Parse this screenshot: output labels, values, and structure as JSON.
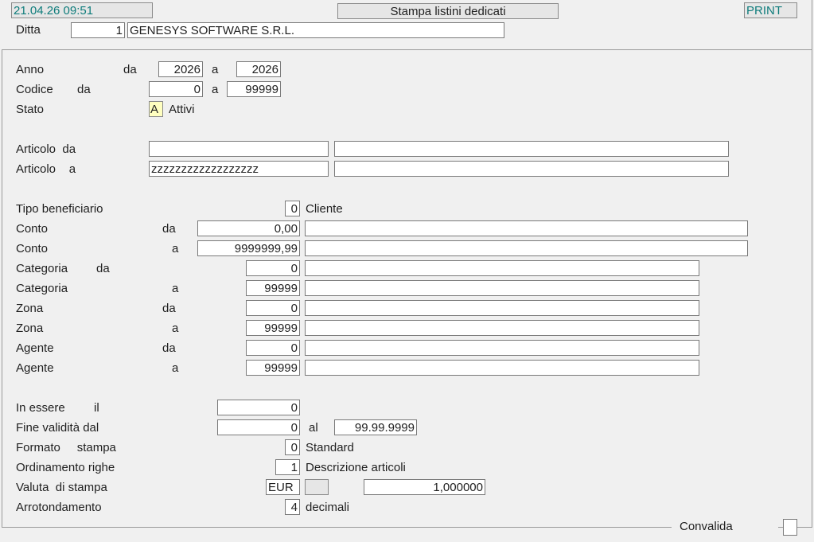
{
  "header": {
    "datetime": "21.04.26 09:51",
    "title": "Stampa listini dedicati",
    "print_label": "PRINT",
    "ditta_label": "Ditta",
    "ditta_code": "1",
    "ditta_name": "GENESYS SOFTWARE S.R.L."
  },
  "form": {
    "anno": {
      "label": "Anno",
      "da": "da",
      "a": "a",
      "from": "2026",
      "to": "2026"
    },
    "codice": {
      "label": "Codice",
      "da": "da",
      "a": "a",
      "from": "0",
      "to": "99999"
    },
    "stato": {
      "label": "Stato",
      "code": "A",
      "desc": "Attivi"
    },
    "articolo_da": {
      "label": "Articolo",
      "suffix": "da",
      "value": "",
      "desc": ""
    },
    "articolo_a": {
      "label": "Articolo",
      "suffix": "a",
      "value": "zzzzzzzzzzzzzzzzzz",
      "desc": ""
    },
    "tipo_beneficiario": {
      "label": "Tipo beneficiario",
      "value": "0",
      "desc": "Cliente"
    },
    "conto_da": {
      "label": "Conto",
      "suffix": "da",
      "value": "0,00",
      "desc": ""
    },
    "conto_a": {
      "label": "Conto",
      "suffix": "a",
      "value": "9999999,99",
      "desc": ""
    },
    "categoria_da": {
      "label": "Categoria",
      "suffix": "da",
      "value": "0",
      "desc": ""
    },
    "categoria_a": {
      "label": "Categoria",
      "suffix": "a",
      "value": "99999",
      "desc": ""
    },
    "zona_da": {
      "label": "Zona",
      "suffix": "da",
      "value": "0",
      "desc": ""
    },
    "zona_a": {
      "label": "Zona",
      "suffix": "a",
      "value": "99999",
      "desc": ""
    },
    "agente_da": {
      "label": "Agente",
      "suffix": "da",
      "value": "0",
      "desc": ""
    },
    "agente_a": {
      "label": "Agente",
      "suffix": "a",
      "value": "99999",
      "desc": ""
    },
    "in_essere": {
      "label": "In essere",
      "suffix": "il",
      "value": "0"
    },
    "fine_validita": {
      "label": "Fine validità dal",
      "from": "0",
      "al": "al",
      "to": "99.99.9999"
    },
    "formato_stampa": {
      "label": "Formato",
      "label2": "stampa",
      "value": "0",
      "desc": "Standard"
    },
    "ordinamento": {
      "label": "Ordinamento righe",
      "value": "1",
      "desc": "Descrizione articoli"
    },
    "valuta": {
      "label": "Valuta",
      "label2": "di stampa",
      "value": "EUR",
      "extra": "",
      "rate": "1,000000"
    },
    "arrotondamento": {
      "label": "Arrotondamento",
      "value": "4",
      "desc": "decimali"
    }
  },
  "footer": {
    "convalida_label": "Convalida"
  }
}
